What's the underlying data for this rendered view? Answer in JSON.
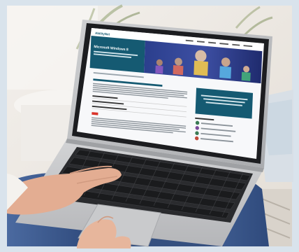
{
  "photo": {
    "subject": "laptop on lap",
    "colors": {
      "border": "#d9e3ec",
      "wall": "#ece7e1",
      "floor": "#e3ddd5",
      "laptop_body": "#c6c7c9",
      "bezel": "#1c1d20",
      "keys": "#2a2b2e",
      "skin": "#e7b69c",
      "jeans": "#3c5a8e",
      "site_teal": "#155a72",
      "site_banner": "#2a3c8a"
    }
  },
  "screen": {
    "site": {
      "logo_text": "AbilityNet",
      "hero_title": "Microsoft Windows 8"
    }
  }
}
